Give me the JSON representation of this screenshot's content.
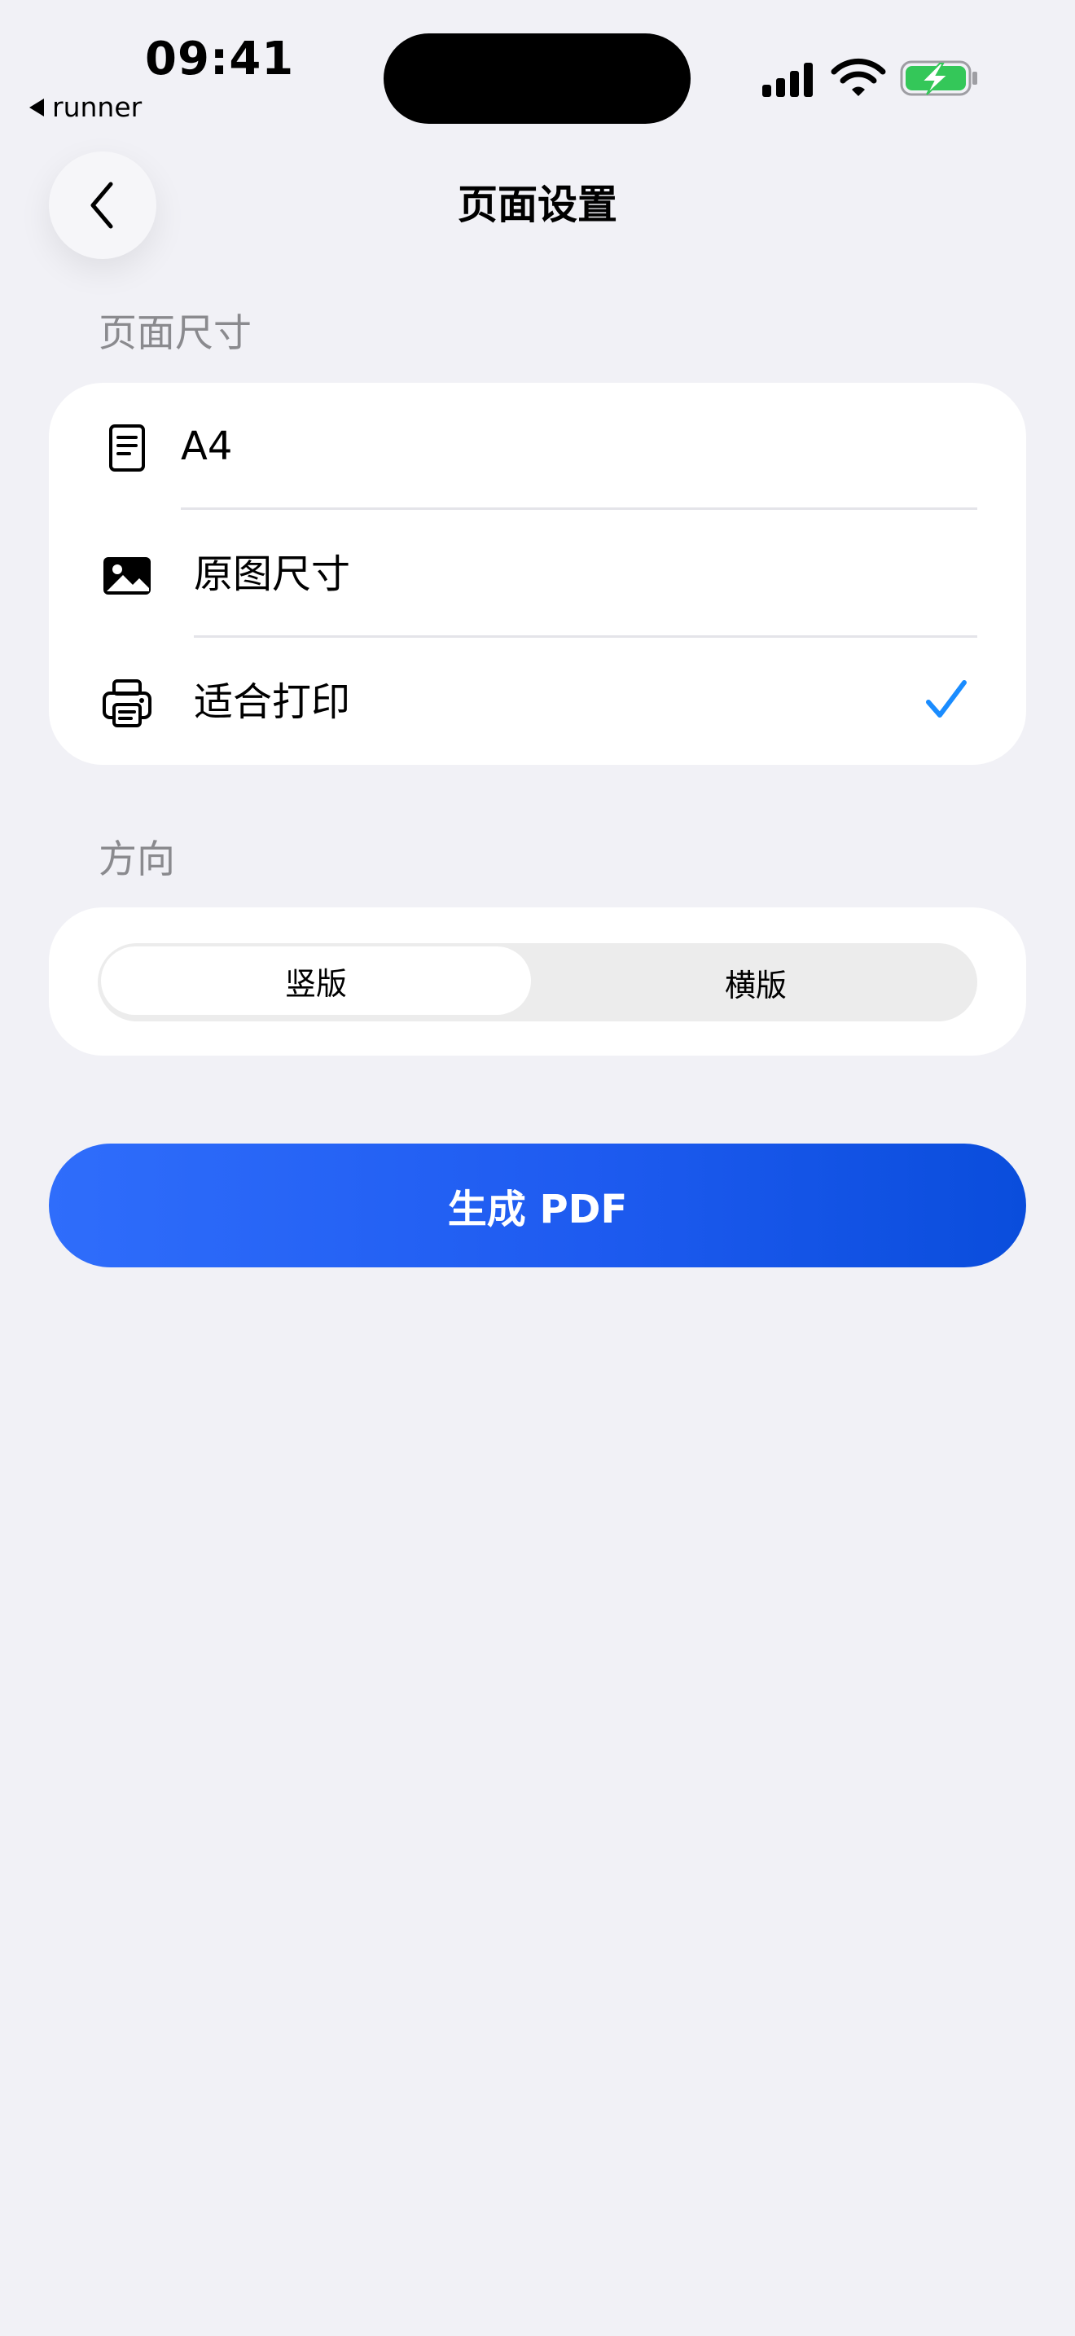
{
  "status_bar": {
    "time": "09:41",
    "back_app": "runner"
  },
  "nav": {
    "title": "页面设置"
  },
  "page_size": {
    "section_label": "页面尺寸",
    "options": [
      {
        "label": "A4",
        "icon": "document-icon",
        "selected": false
      },
      {
        "label": "原图尺寸",
        "icon": "image-icon",
        "selected": false
      },
      {
        "label": "适合打印",
        "icon": "printer-icon",
        "selected": true
      }
    ]
  },
  "orientation": {
    "section_label": "方向",
    "options": [
      {
        "label": "竖版",
        "selected": true
      },
      {
        "label": "横版",
        "selected": false
      }
    ]
  },
  "primary_action": {
    "label": "生成 PDF"
  },
  "colors": {
    "background": "#F1F1F6",
    "accent": "#1E5BF0",
    "check": "#1A8CFF",
    "battery": "#34C759"
  }
}
